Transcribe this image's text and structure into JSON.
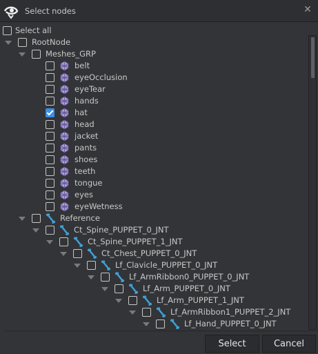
{
  "window": {
    "title": "Select nodes",
    "close_icon": "close-icon",
    "logo_icon": "app-logo-icon"
  },
  "select_all": {
    "label": "Select all",
    "checked": false
  },
  "colors": {
    "accent": "#3d8ee6",
    "mesh_icon": "#a99ad8",
    "joint_icon": "#3ea0d6"
  },
  "tree": [
    {
      "label": "RootNode",
      "level": 1,
      "expandable": true,
      "icon": null,
      "checked": false
    },
    {
      "label": "Meshes_GRP",
      "level": 2,
      "expandable": true,
      "icon": null,
      "checked": false
    },
    {
      "label": "belt",
      "level": 3,
      "expandable": false,
      "icon": "mesh-icon",
      "checked": false
    },
    {
      "label": "eyeOcclusion",
      "level": 3,
      "expandable": false,
      "icon": "mesh-icon",
      "checked": false
    },
    {
      "label": "eyeTear",
      "level": 3,
      "expandable": false,
      "icon": "mesh-icon",
      "checked": false
    },
    {
      "label": "hands",
      "level": 3,
      "expandable": false,
      "icon": "mesh-icon",
      "checked": false
    },
    {
      "label": "hat",
      "level": 3,
      "expandable": false,
      "icon": "mesh-icon",
      "checked": true
    },
    {
      "label": "head",
      "level": 3,
      "expandable": false,
      "icon": "mesh-icon",
      "checked": false
    },
    {
      "label": "jacket",
      "level": 3,
      "expandable": false,
      "icon": "mesh-icon",
      "checked": false
    },
    {
      "label": "pants",
      "level": 3,
      "expandable": false,
      "icon": "mesh-icon",
      "checked": false
    },
    {
      "label": "shoes",
      "level": 3,
      "expandable": false,
      "icon": "mesh-icon",
      "checked": false
    },
    {
      "label": "teeth",
      "level": 3,
      "expandable": false,
      "icon": "mesh-icon",
      "checked": false
    },
    {
      "label": "tongue",
      "level": 3,
      "expandable": false,
      "icon": "mesh-icon",
      "checked": false
    },
    {
      "label": "eyes",
      "level": 3,
      "expandable": false,
      "icon": "mesh-icon",
      "checked": false
    },
    {
      "label": "eyeWetness",
      "level": 3,
      "expandable": false,
      "icon": "mesh-icon",
      "checked": false
    },
    {
      "label": "Reference",
      "level": 2,
      "expandable": true,
      "icon": "joint-icon",
      "checked": false
    },
    {
      "label": "Ct_Spine_PUPPET_0_JNT",
      "level": 3,
      "expandable": true,
      "icon": "joint-icon",
      "checked": false
    },
    {
      "label": "Ct_Spine_PUPPET_1_JNT",
      "level": 4,
      "expandable": true,
      "icon": "joint-icon",
      "checked": false
    },
    {
      "label": "Ct_Chest_PUPPET_0_JNT",
      "level": 5,
      "expandable": true,
      "icon": "joint-icon",
      "checked": false
    },
    {
      "label": "Lf_Clavicle_PUPPET_0_JNT",
      "level": 6,
      "expandable": true,
      "icon": "joint-icon",
      "checked": false
    },
    {
      "label": "Lf_ArmRibbon0_PUPPET_0_JNT",
      "level": 7,
      "expandable": true,
      "icon": "joint-icon",
      "checked": false
    },
    {
      "label": "Lf_Arm_PUPPET_0_JNT",
      "level": 8,
      "expandable": true,
      "icon": "joint-icon",
      "checked": false
    },
    {
      "label": "Lf_Arm_PUPPET_1_JNT",
      "level": 9,
      "expandable": true,
      "icon": "joint-icon",
      "checked": false
    },
    {
      "label": "Lf_ArmRibbon1_PUPPET_2_JNT",
      "level": 10,
      "expandable": true,
      "icon": "joint-icon",
      "checked": false
    },
    {
      "label": "Lf_Hand_PUPPET_0_JNT",
      "level": 11,
      "expandable": true,
      "icon": "joint-icon",
      "checked": false
    }
  ],
  "buttons": {
    "select": "Select",
    "cancel": "Cancel"
  }
}
